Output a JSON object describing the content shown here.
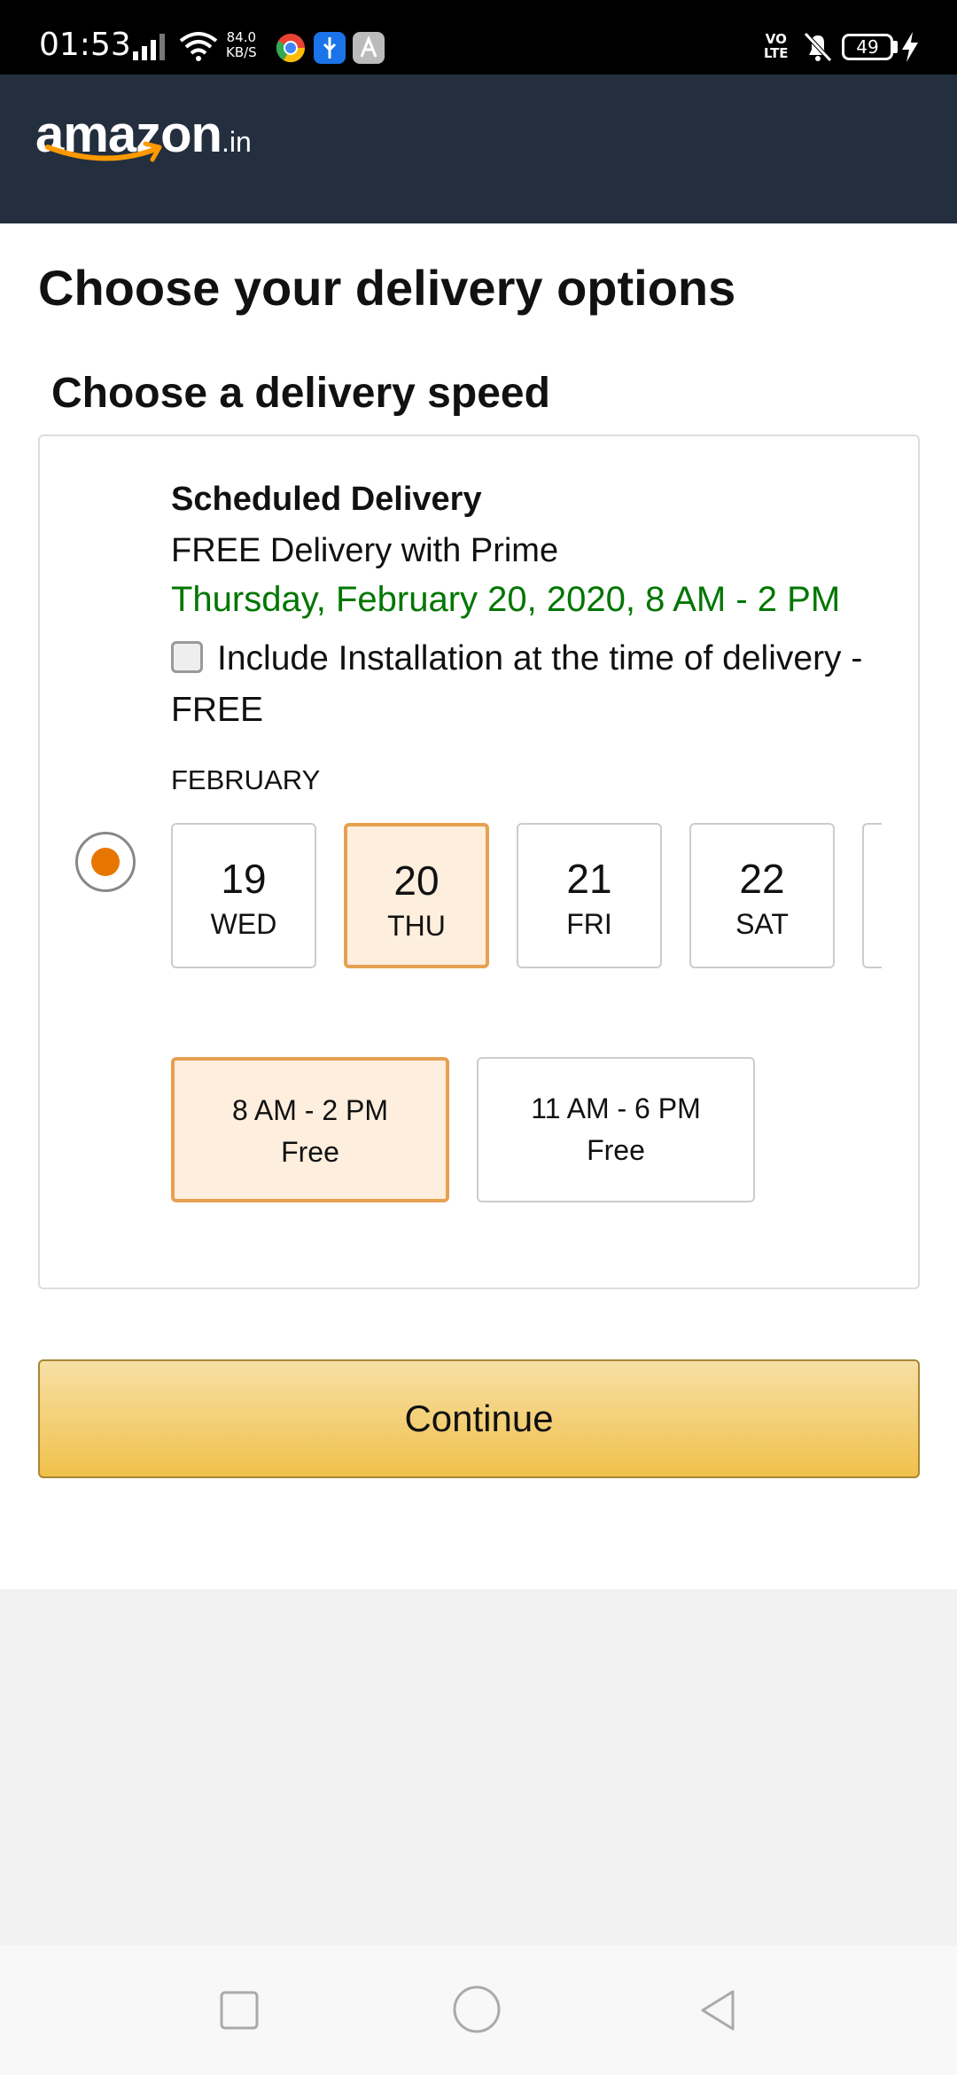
{
  "status_bar": {
    "time": "01:53",
    "net_speed_value": "84.0",
    "net_speed_unit": "KB/S",
    "volte_top": "VO",
    "volte_bottom": "LTE",
    "battery": "49"
  },
  "header": {
    "logo_main": "amazon",
    "logo_suffix": ".in",
    "brand_color": "#232f3e",
    "accent_color": "#ff9900"
  },
  "page": {
    "title": "Choose your delivery options",
    "section_title": "Choose a delivery speed"
  },
  "delivery_option": {
    "title": "Scheduled Delivery",
    "description": "FREE Delivery with Prime",
    "date_text": "Thursday, February 20, 2020, 8 AM - 2 PM",
    "install_label": "Include Installation at the time of delivery - FREE",
    "install_checked": false,
    "selected": true,
    "month": "FEBRUARY",
    "dates": [
      {
        "num": "19",
        "day": "WED"
      },
      {
        "num": "20",
        "day": "THU"
      },
      {
        "num": "21",
        "day": "FRI"
      },
      {
        "num": "22",
        "day": "SAT"
      }
    ],
    "selected_date": "20",
    "slots": [
      {
        "time": "8 AM - 2 PM",
        "price": "Free"
      },
      {
        "time": "11 AM - 6 PM",
        "price": "Free"
      }
    ],
    "selected_slot": "8 AM - 2 PM"
  },
  "continue_label": "Continue",
  "colors": {
    "date_green": "#007600",
    "selection_orange": "#e7a050",
    "radio_orange": "#e77600",
    "button_yellow": "#f0c14b"
  }
}
